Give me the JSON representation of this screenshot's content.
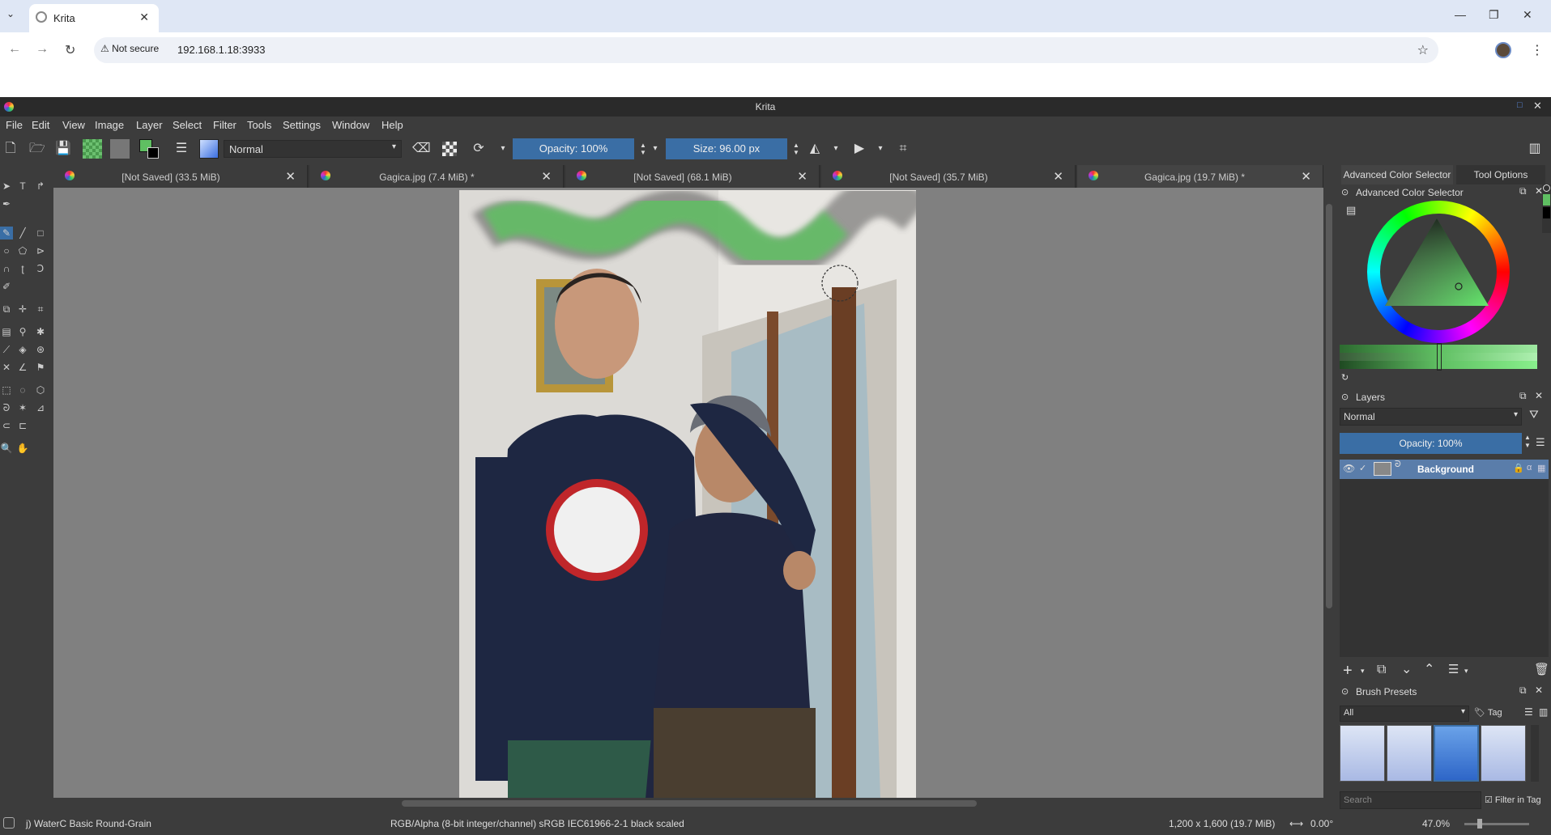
{
  "browser": {
    "tab_title": "Krita",
    "not_secure_label": "Not secure",
    "url": "192.168.1.18:3933"
  },
  "app": {
    "title": "Krita",
    "menu": [
      "File",
      "Edit",
      "View",
      "Image",
      "Layer",
      "Select",
      "Filter",
      "Tools",
      "Settings",
      "Window",
      "Help"
    ]
  },
  "toolbar": {
    "blend_mode": "Normal",
    "opacity": "Opacity: 100%",
    "size": "Size: 96.00 px"
  },
  "documents": [
    {
      "label": "[Not Saved]  (33.5 MiB)"
    },
    {
      "label": "Gagica.jpg (7.4 MiB) *"
    },
    {
      "label": "[Not Saved]  (68.1 MiB)"
    },
    {
      "label": "[Not Saved]  (35.7 MiB)"
    },
    {
      "label": "Gagica.jpg (19.7 MiB) *"
    }
  ],
  "dock_tabs": {
    "color_selector": "Advanced Color Selector",
    "tool_options": "Tool Options"
  },
  "color_selector": {
    "title": "Advanced Color Selector",
    "selected_color": "#5fbf62"
  },
  "layers": {
    "title": "Layers",
    "blend_mode": "Normal",
    "opacity": "Opacity:  100%",
    "items": [
      {
        "name": "Background"
      }
    ]
  },
  "brush_presets": {
    "title": "Brush Presets",
    "filter": "All",
    "tag_label": "Tag",
    "search_placeholder": "Search",
    "filter_in_tag": "Filter in Tag"
  },
  "status": {
    "brush_name": "j) WaterC Basic Round-Grain",
    "color_profile": "RGB/Alpha (8-bit integer/channel)  sRGB IEC61966-2-1 black scaled",
    "image_size": "1,200 x 1,600 (19.7 MiB)",
    "rotation": "0.00°",
    "zoom": "47.0%"
  },
  "colors": {
    "accent": "#3a6ea5",
    "panel": "#3c3c3c"
  }
}
